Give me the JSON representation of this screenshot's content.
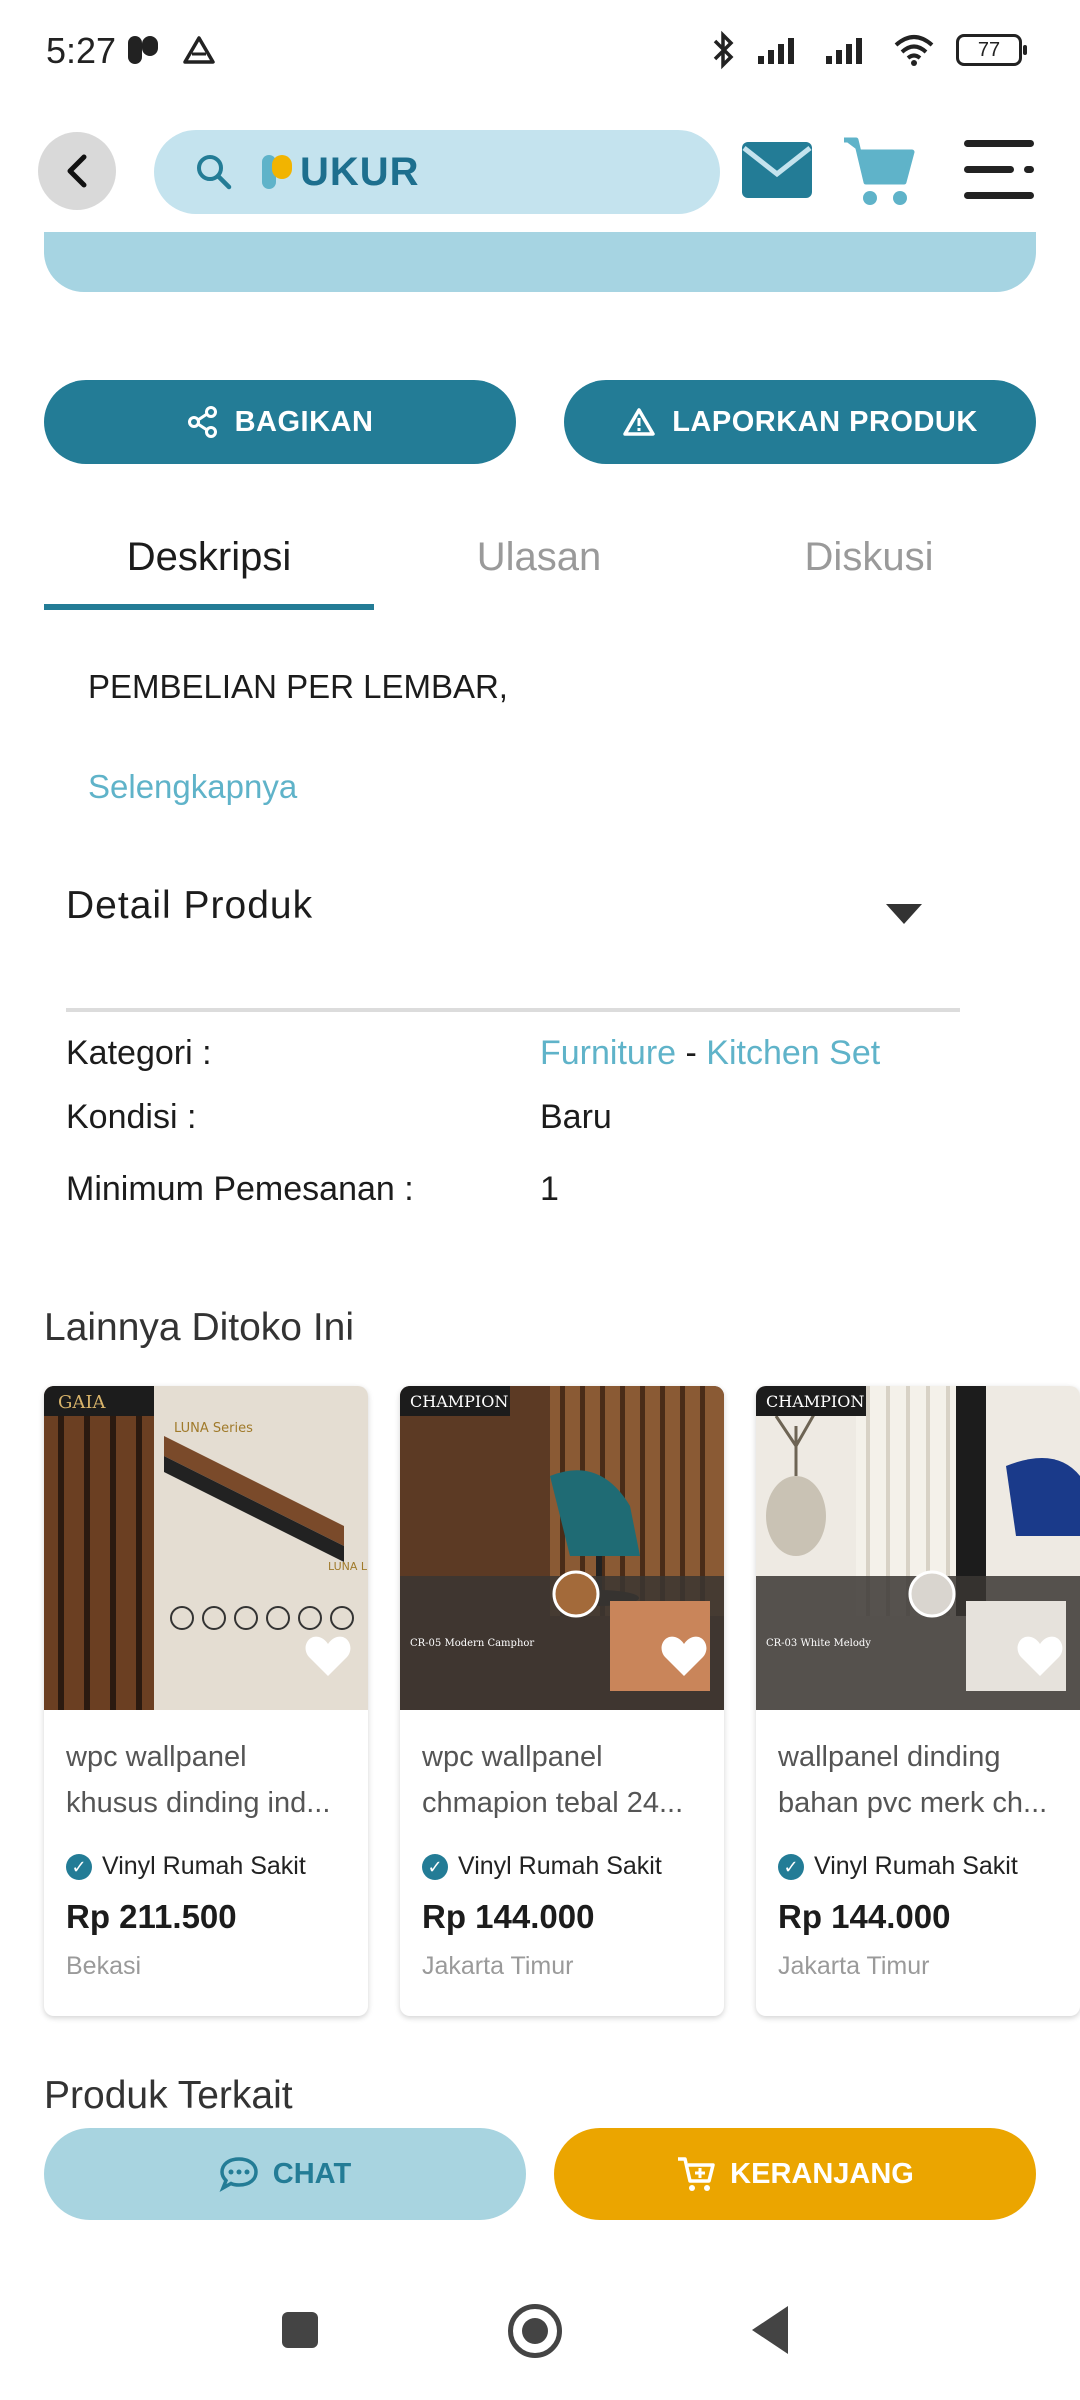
{
  "status": {
    "time": "5:27",
    "battery": "77"
  },
  "header": {
    "logo_text": "UKUR"
  },
  "actions": {
    "share_label": "BAGIKAN",
    "report_label": "LAPORKAN PRODUK"
  },
  "tabs": [
    {
      "label": "Deskripsi",
      "active": true
    },
    {
      "label": "Ulasan",
      "active": false
    },
    {
      "label": "Diskusi",
      "active": false
    }
  ],
  "description": {
    "text": "PEMBELIAN PER LEMBAR,",
    "more_label": "Selengkapnya"
  },
  "detail": {
    "title": "Detail Produk",
    "category_label": "Kategori :",
    "category_main": "Furniture",
    "category_sep": "-",
    "category_sub": "Kitchen Set",
    "condition_label": "Kondisi :",
    "condition_value": "Baru",
    "min_order_label": "Minimum Pemesanan :",
    "min_order_value": "1"
  },
  "other_section": {
    "title": "Lainnya Ditoko Ini",
    "products": [
      {
        "name_line1": "wpc wallpanel",
        "name_line2": "khusus dinding ind...",
        "seller": "Vinyl Rumah Sakit",
        "price": "Rp 211.500",
        "location": "Bekasi",
        "brand": "GAIA",
        "series": "LUNA Series",
        "variant": "LUNA Light Oak"
      },
      {
        "name_line1": "wpc wallpanel",
        "name_line2": "chmapion tebal 24...",
        "seller": "Vinyl Rumah Sakit",
        "price": "Rp 144.000",
        "location": "Jakarta Timur",
        "brand": "CHAMPION",
        "variant": "CR-05 Modern Camphor"
      },
      {
        "name_line1": "wallpanel dinding",
        "name_line2": "bahan pvc merk ch...",
        "seller": "Vinyl Rumah Sakit",
        "price": "Rp 144.000",
        "location": "Jakarta Timur",
        "brand": "CHAMPION",
        "variant": "CR-03 White Melody"
      }
    ]
  },
  "next_section": {
    "title": "Produk Terkait"
  },
  "bottom_bar": {
    "chat_label": "CHAT",
    "cart_label": "KERANJANG"
  },
  "colors": {
    "primary": "#237c96",
    "accent_yellow": "#eba500",
    "link": "#5fb3c9",
    "light_blue": "#c4e3ee"
  },
  "icons": [
    "back-icon",
    "search-icon",
    "mail-icon",
    "cart-icon",
    "menu-icon",
    "share-icon",
    "warning-icon",
    "caret-down-icon",
    "heart-icon",
    "verified-icon",
    "chat-bubble-icon",
    "cart-plus-icon"
  ]
}
